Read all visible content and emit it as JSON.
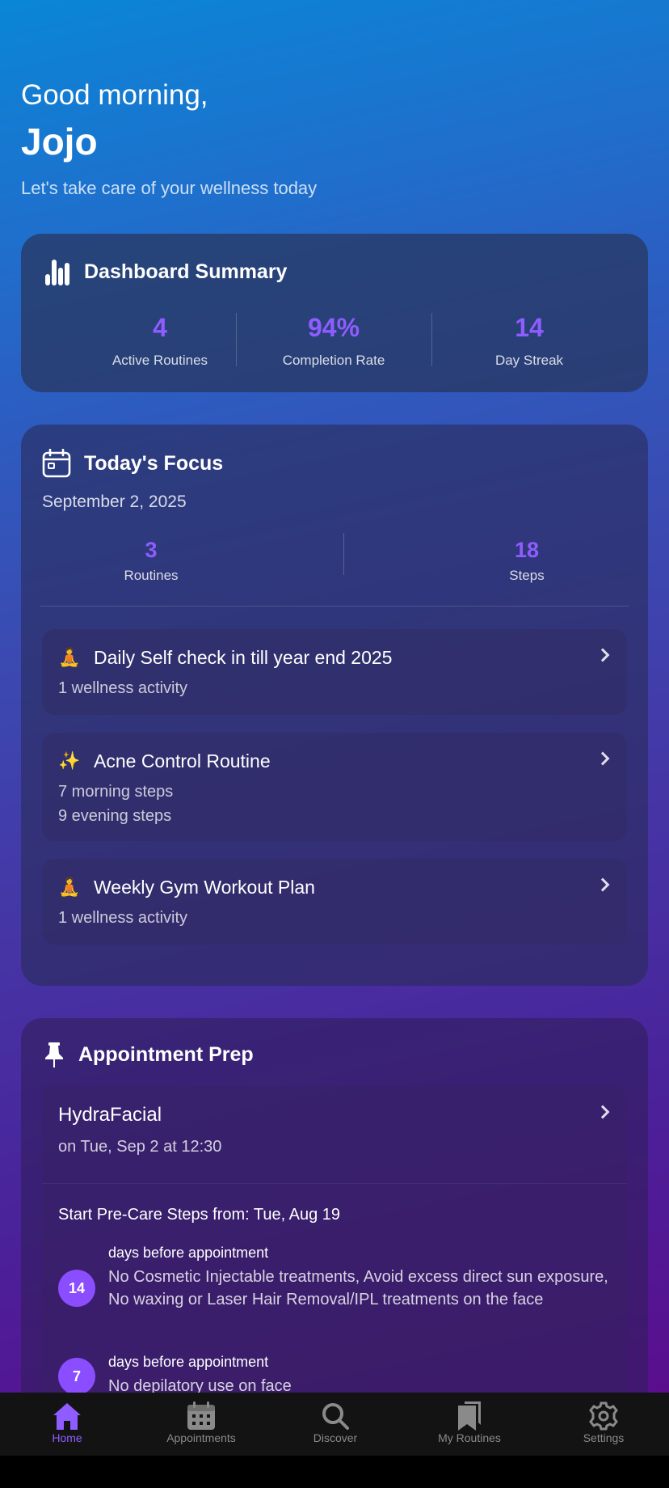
{
  "header": {
    "greeting": "Good morning,",
    "username": "Jojo",
    "tagline": "Let's take care of your wellness today"
  },
  "summary": {
    "title": "Dashboard Summary",
    "icon": "bar-chart-icon",
    "stats": [
      {
        "value": "4",
        "label": "Active Routines"
      },
      {
        "value": "94%",
        "label": "Completion Rate"
      },
      {
        "value": "14",
        "label": "Day Streak"
      }
    ]
  },
  "focus": {
    "title": "Today's Focus",
    "icon": "calendar-icon",
    "date": "September 2, 2025",
    "stats": [
      {
        "value": "3",
        "label": "Routines"
      },
      {
        "value": "18",
        "label": "Steps"
      }
    ],
    "routines": [
      {
        "emoji": "🧘",
        "name": "Daily Self check in till year end 2025",
        "lines": [
          "1 wellness activity"
        ]
      },
      {
        "emoji": "✨",
        "name": "Acne Control Routine",
        "lines": [
          "7 morning steps",
          "9 evening steps"
        ]
      },
      {
        "emoji": "🧘",
        "name": "Weekly Gym Workout Plan",
        "lines": [
          "1 wellness activity"
        ]
      }
    ]
  },
  "appointment": {
    "title": "Appointment Prep",
    "icon": "pin-icon",
    "service": "HydraFacial",
    "time": "on Tue, Sep 2 at 12:30",
    "precare": "Start Pre-Care Steps from: Tue, Aug 19",
    "steps": [
      {
        "days": "14",
        "label": "days before appointment",
        "text": "No Cosmetic Injectable treatments, Avoid excess direct sun exposure, No waxing or Laser Hair Removal/IPL treatments on the face"
      },
      {
        "days": "7",
        "label": "days before appointment",
        "text": "No depilatory use on face"
      }
    ]
  },
  "nav": {
    "items": [
      {
        "label": "Home",
        "icon": "home-icon",
        "active": true
      },
      {
        "label": "Appointments",
        "icon": "calendar-icon",
        "active": false
      },
      {
        "label": "Discover",
        "icon": "search-icon",
        "active": false
      },
      {
        "label": "My Routines",
        "icon": "bookmarks-icon",
        "active": false
      },
      {
        "label": "Settings",
        "icon": "gear-icon",
        "active": false
      }
    ]
  },
  "colors": {
    "accent": "#8f5cff",
    "nav_bg": "#131313"
  }
}
